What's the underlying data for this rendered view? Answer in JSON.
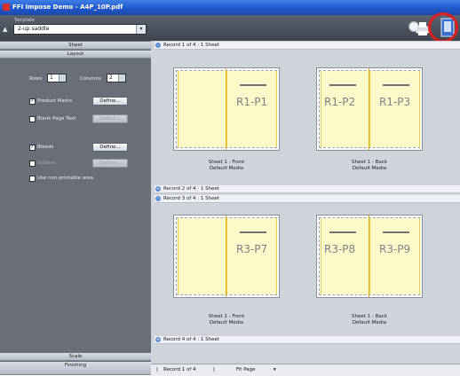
{
  "window": {
    "title": "FFI Impose Demo - A4P_10P.pdf"
  },
  "toolbar": {
    "template_label": "Template",
    "template_value": "2-up saddle",
    "icons": [
      "search-icon",
      "print-icon",
      "imposition-view-icon"
    ],
    "highlight_color": "#e02020"
  },
  "side": {
    "tabs": {
      "sheet": "Sheet",
      "layout": "Layout",
      "scale": "Scale",
      "finishing": "Finishing"
    },
    "rows_label": "Rows",
    "rows_value": "1",
    "columns_label": "Columns",
    "columns_value": "2",
    "products_label": "Product Marks",
    "products_button": "Define...",
    "blank_page_label": "Blank Page Text",
    "blank_page_button": "Define...",
    "bleeds_label": "Bleeds",
    "bleeds_button": "Define...",
    "gutters_label": "Gutters",
    "gutters_button": "Define...",
    "nonprintable_label": "Use non-printable area"
  },
  "records": [
    {
      "text": "Record 1 of 4 : 1 Sheet",
      "toggle": "-"
    },
    {
      "text": "Record 2 of 4 : 1 Sheet",
      "toggle": "+"
    },
    {
      "text": "Record 3 of 4 : 1 Sheet",
      "toggle": "-"
    },
    {
      "text": "Record 4 of 4 : 1 Sheet",
      "toggle": "+"
    }
  ],
  "sheets": [
    {
      "left": "",
      "right": "R1-P1",
      "caption1": "Sheet 1 - Front",
      "caption2": "Default Media"
    },
    {
      "left": "R1-P2",
      "right": "R1-P3",
      "caption1": "Sheet 1 - Back",
      "caption2": "Default Media"
    },
    {
      "left": "",
      "right": "R3-P7",
      "caption1": "Sheet 1 - Front",
      "caption2": "Default Media"
    },
    {
      "left": "R3-P8",
      "right": "R3-P9",
      "caption1": "Sheet 1 - Back",
      "caption2": "Default Media"
    }
  ],
  "status": {
    "record": "Record 1 of 4",
    "zoom": "Fit Page"
  }
}
